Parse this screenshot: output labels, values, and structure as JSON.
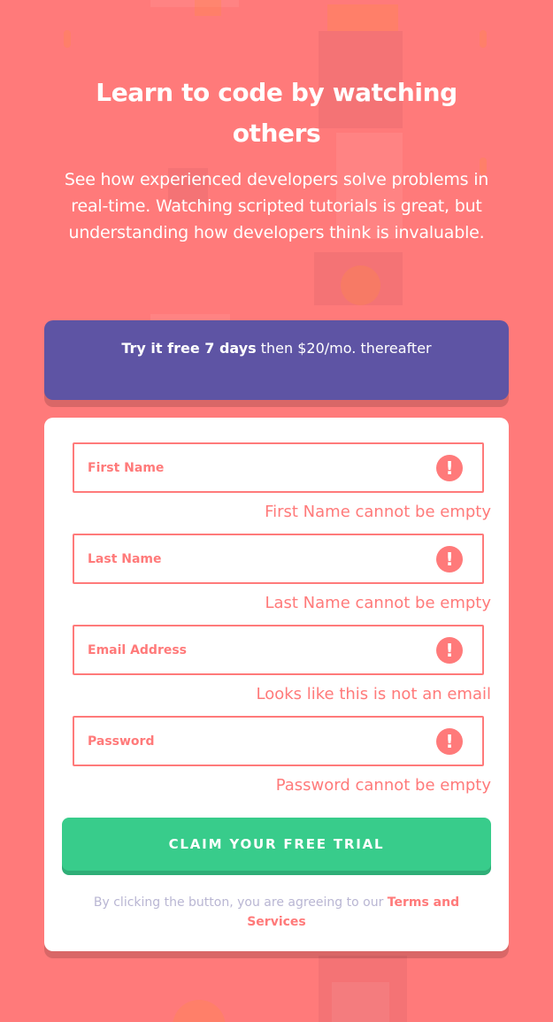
{
  "hero": {
    "title": "Learn to code by watching others",
    "description": "See how experienced developers solve problems in real-time. Watching scripted tutorials is great, but understanding how developers think is invaluable."
  },
  "offer": {
    "bold": "Try it free 7 days",
    "rest": " then $20/mo. thereafter"
  },
  "form": {
    "fields": [
      {
        "placeholder": "First Name",
        "error": "First Name cannot be empty"
      },
      {
        "placeholder": "Last Name",
        "error": "Last Name cannot be empty"
      },
      {
        "placeholder": "Email Address",
        "error": "Looks like this is not an email"
      },
      {
        "placeholder": "Password",
        "error": "Password cannot be empty"
      }
    ],
    "error_icon": "!",
    "submit_label": "CLAIM YOUR FREE TRIAL",
    "terms_prefix": "By clicking the button, you are agreeing to our ",
    "terms_link": "Terms and Services"
  },
  "colors": {
    "background": "#ff7a7a",
    "offer": "#5e54a4",
    "button": "#38cc8b",
    "error": "#ff7a7a",
    "muted": "#b9b6d3"
  }
}
